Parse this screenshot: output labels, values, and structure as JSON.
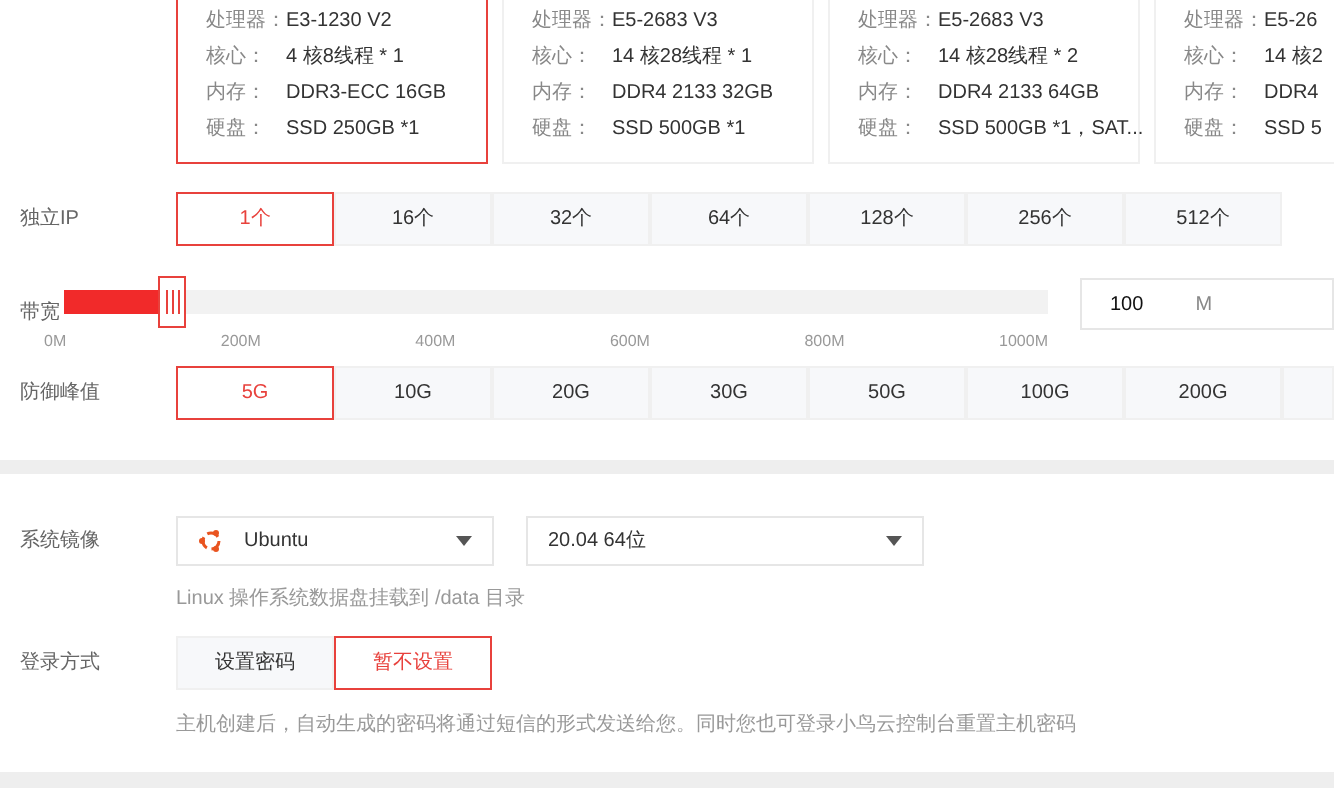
{
  "servers": [
    {
      "selected": true,
      "specs": [
        {
          "label": "处理器：",
          "value": "E3-1230 V2"
        },
        {
          "label": "核心：",
          "value": "4 核8线程 * 1"
        },
        {
          "label": "内存：",
          "value": "DDR3-ECC 16GB"
        },
        {
          "label": "硬盘：",
          "value": "SSD 250GB *1"
        }
      ]
    },
    {
      "selected": false,
      "specs": [
        {
          "label": "处理器：",
          "value": "E5-2683 V3"
        },
        {
          "label": "核心：",
          "value": "14 核28线程 * 1"
        },
        {
          "label": "内存：",
          "value": "DDR4 2133 32GB"
        },
        {
          "label": "硬盘：",
          "value": "SSD 500GB *1"
        }
      ]
    },
    {
      "selected": false,
      "specs": [
        {
          "label": "处理器：",
          "value": "E5-2683 V3"
        },
        {
          "label": "核心：",
          "value": "14 核28线程 * 2"
        },
        {
          "label": "内存：",
          "value": "DDR4 2133 64GB"
        },
        {
          "label": "硬盘：",
          "value": "SSD 500GB *1，SAT..."
        }
      ]
    },
    {
      "selected": false,
      "specs": [
        {
          "label": "处理器：",
          "value": "E5-26"
        },
        {
          "label": "核心：",
          "value": "14 核2"
        },
        {
          "label": "内存：",
          "value": "DDR4"
        },
        {
          "label": "硬盘：",
          "value": "SSD 5"
        }
      ]
    }
  ],
  "ip": {
    "label": "独立IP",
    "options": [
      {
        "label": "1个",
        "selected": true
      },
      {
        "label": "16个",
        "selected": false
      },
      {
        "label": "32个",
        "selected": false
      },
      {
        "label": "64个",
        "selected": false
      },
      {
        "label": "128个",
        "selected": false
      },
      {
        "label": "256个",
        "selected": false
      },
      {
        "label": "512个",
        "selected": false
      }
    ]
  },
  "bandwidth": {
    "label": "带宽",
    "level": 0.11,
    "ticks": [
      "0M",
      "200M",
      "400M",
      "600M",
      "800M",
      "1000M"
    ],
    "value": "100",
    "unit": "M"
  },
  "defense": {
    "label": "防御峰值",
    "options": [
      {
        "label": "5G",
        "selected": true
      },
      {
        "label": "10G",
        "selected": false
      },
      {
        "label": "20G",
        "selected": false
      },
      {
        "label": "30G",
        "selected": false
      },
      {
        "label": "50G",
        "selected": false
      },
      {
        "label": "100G",
        "selected": false
      },
      {
        "label": "200G",
        "selected": false
      }
    ]
  },
  "image": {
    "label": "系统镜像",
    "os": "Ubuntu",
    "version": "20.04 64位",
    "hint": "Linux 操作系统数据盘挂载到 /data 目录"
  },
  "login": {
    "label": "登录方式",
    "options": [
      {
        "label": "设置密码",
        "selected": false
      },
      {
        "label": "暂不设置",
        "selected": true
      }
    ],
    "hint": "主机创建后，自动生成的密码将通过短信的形式发送给您。同时您也可登录小鸟云控制台重置主机密码"
  }
}
